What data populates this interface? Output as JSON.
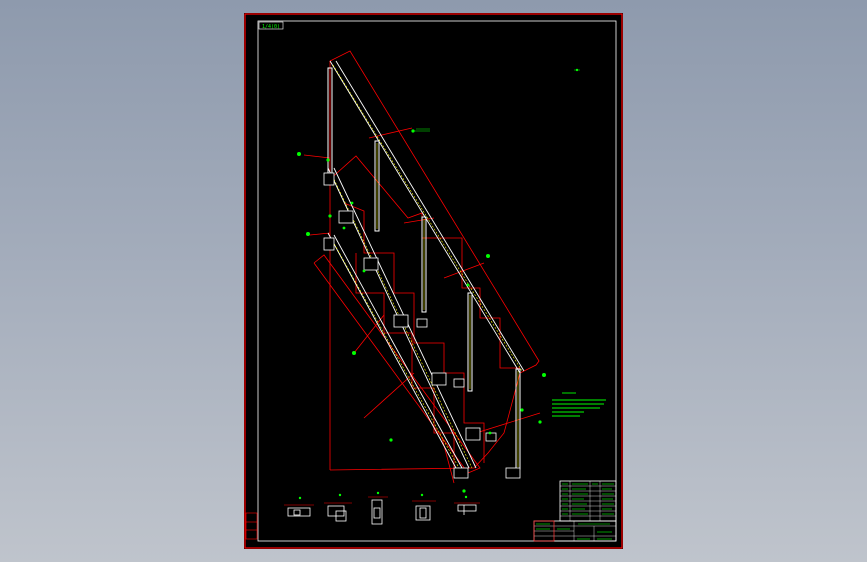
{
  "drawing": {
    "sheet_tag": "1/4(0)",
    "colors": {
      "background": "#000000",
      "frame": "#ff0000",
      "primary_lines": "#ffffff",
      "secondary_lines": "#ffff00",
      "annotation": "#00ff00",
      "canvas": "#a3acbb"
    }
  }
}
